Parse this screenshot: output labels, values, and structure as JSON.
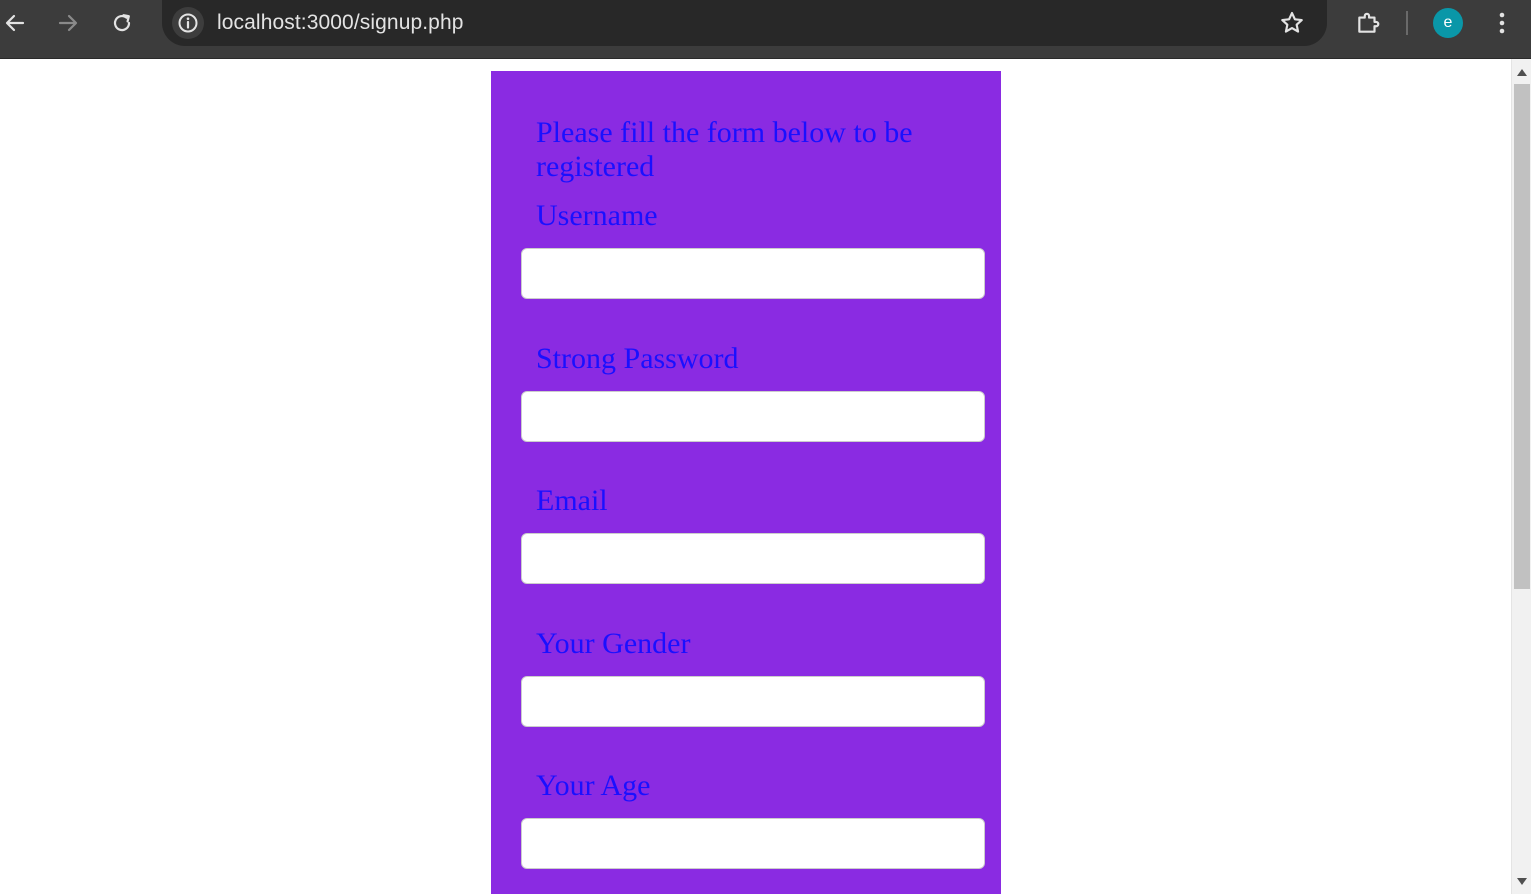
{
  "browser": {
    "url": "localhost:3000/signup.php",
    "profile_initial": "e",
    "profile_color": "#0a97a8",
    "icons": {
      "back": "arrow-left-icon",
      "forward": "arrow-right-icon",
      "reload": "reload-icon",
      "site_info": "info-icon",
      "bookmark": "star-icon",
      "extensions": "puzzle-icon",
      "menu": "kebab-menu-icon"
    }
  },
  "form": {
    "heading": "Please fill the form below to be registered",
    "background_color": "#8a2be2",
    "text_color": "#1a10ff",
    "fields": [
      {
        "label": "Username",
        "value": "",
        "placeholder": ""
      },
      {
        "label": "Strong Password",
        "value": "",
        "placeholder": ""
      },
      {
        "label": "Email",
        "value": "",
        "placeholder": ""
      },
      {
        "label": "Your Gender",
        "value": "",
        "placeholder": ""
      },
      {
        "label": "Your Age",
        "value": "",
        "placeholder": ""
      }
    ]
  }
}
